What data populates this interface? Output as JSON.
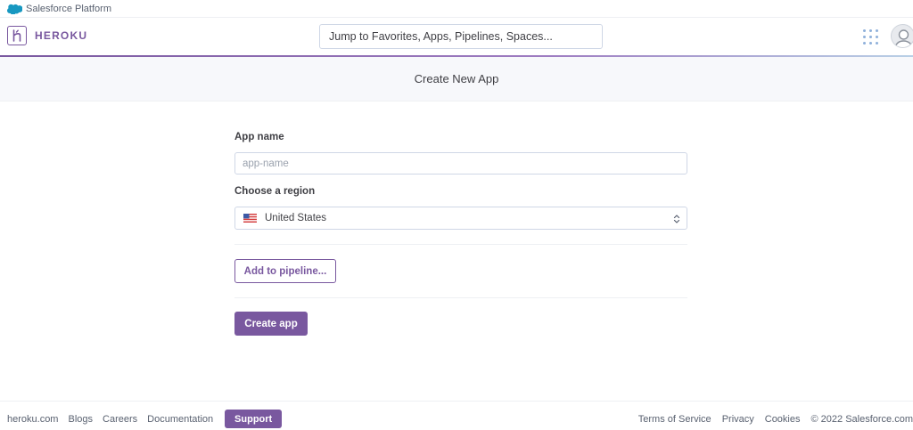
{
  "salesforce_bar": {
    "label": "Salesforce Platform",
    "icon": "salesforce-cloud-icon"
  },
  "nav": {
    "logo_text": "HEROKU",
    "logo_icon": "heroku-logo-icon",
    "search_placeholder": "Jump to Favorites, Apps, Pipelines, Spaces...",
    "apps_icon": "apps-grid-icon",
    "avatar_icon": "user-avatar-icon"
  },
  "page": {
    "title": "Create New App"
  },
  "form": {
    "app_name_label": "App name",
    "app_name_value": "",
    "app_name_placeholder": "app-name",
    "region_label": "Choose a region",
    "region_value": "United States",
    "region_flag_icon": "us-flag-icon",
    "add_pipeline_label": "Add to pipeline...",
    "create_label": "Create app"
  },
  "footer": {
    "links": [
      "heroku.com",
      "Blogs",
      "Careers",
      "Documentation"
    ],
    "support_label": "Support",
    "right_links": [
      "Terms of Service",
      "Privacy",
      "Cookies"
    ],
    "copyright": "© 2022 Salesforce.com"
  },
  "colors": {
    "brand_purple": "#79589f",
    "text": "#3f3f44",
    "border": "#cfd7e6",
    "subheader_bg": "#f7f8fb"
  }
}
